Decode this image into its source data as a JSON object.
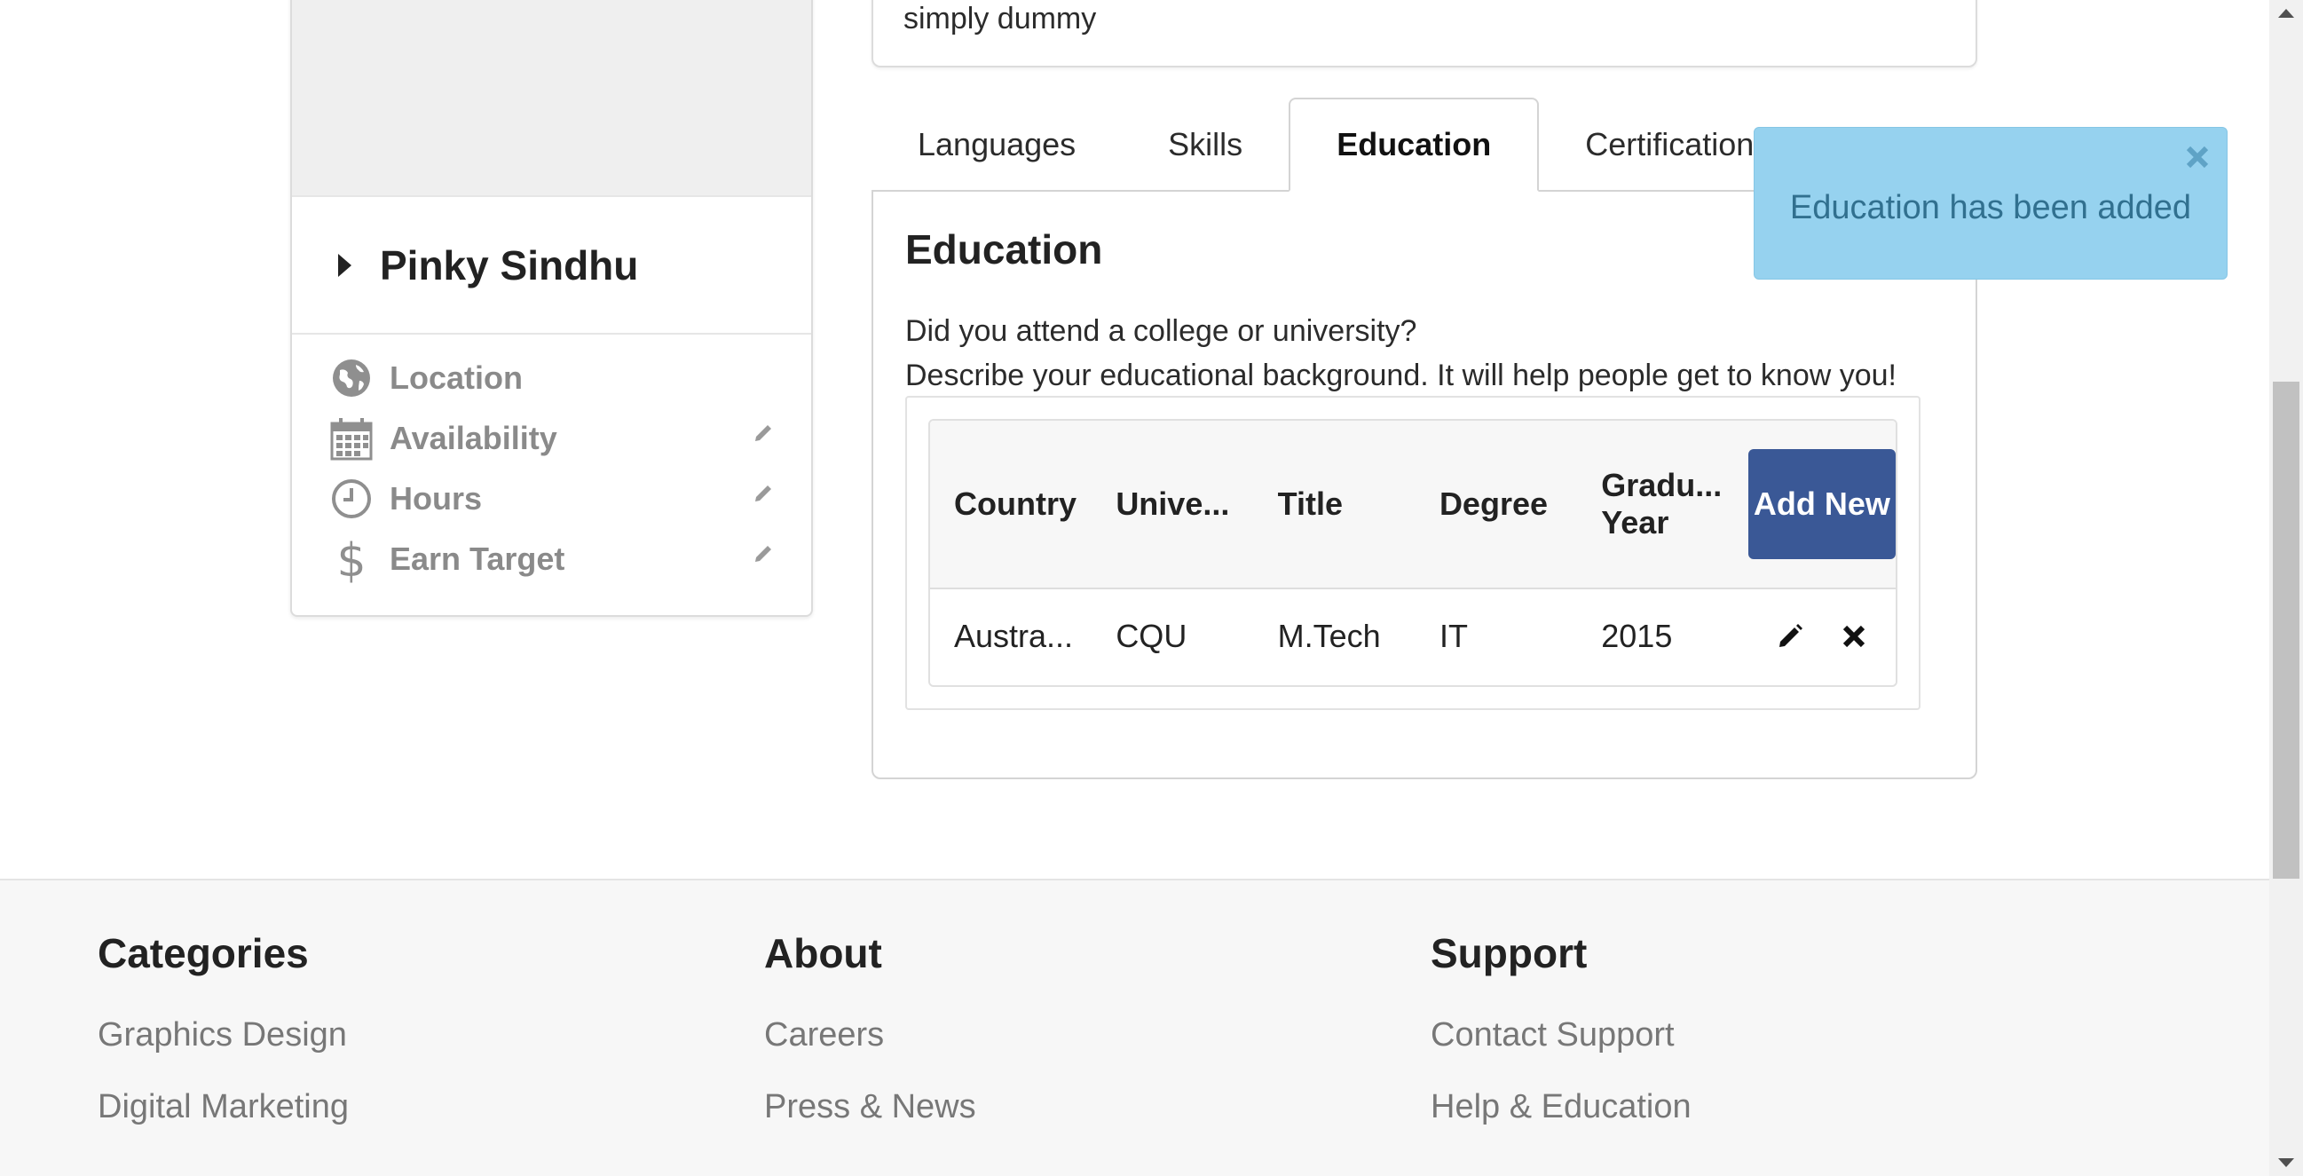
{
  "profile": {
    "name": "Pinky Sindhu",
    "meta": [
      {
        "label": "Location",
        "icon": "globe-icon",
        "editable": false
      },
      {
        "label": "Availability",
        "icon": "calendar-icon",
        "editable": true
      },
      {
        "label": "Hours",
        "icon": "clock-icon",
        "editable": true
      },
      {
        "label": "Earn Target",
        "icon": "dollar-icon",
        "editable": true
      }
    ]
  },
  "description": {
    "text": "simply dummy"
  },
  "tabs": [
    {
      "label": "Languages",
      "active": false
    },
    {
      "label": "Skills",
      "active": false
    },
    {
      "label": "Education",
      "active": true
    },
    {
      "label": "Certifications",
      "active": false
    }
  ],
  "education": {
    "title": "Education",
    "line1": "Did you attend a college or university?",
    "line2": "Describe your educational background. It will help people get to know you!",
    "table": {
      "headers": [
        "Country",
        "Unive...",
        "Title",
        "Degree",
        "Gradu... Year"
      ],
      "add_button": "Add New",
      "rows": [
        {
          "country": "Austra...",
          "university": "CQU",
          "title": "M.Tech",
          "degree": "IT",
          "year": "2015"
        }
      ]
    }
  },
  "toast": {
    "message": "Education has been added",
    "color": "#96d2ef"
  },
  "footer": {
    "columns": [
      {
        "heading": "Categories",
        "links": [
          "Graphics Design",
          "Digital Marketing"
        ]
      },
      {
        "heading": "About",
        "links": [
          "Careers",
          "Press & News"
        ]
      },
      {
        "heading": "Support",
        "links": [
          "Contact Support",
          "Help & Education"
        ]
      }
    ]
  },
  "colors": {
    "primary_button": "#3a5896",
    "toast_text": "#31708f"
  }
}
